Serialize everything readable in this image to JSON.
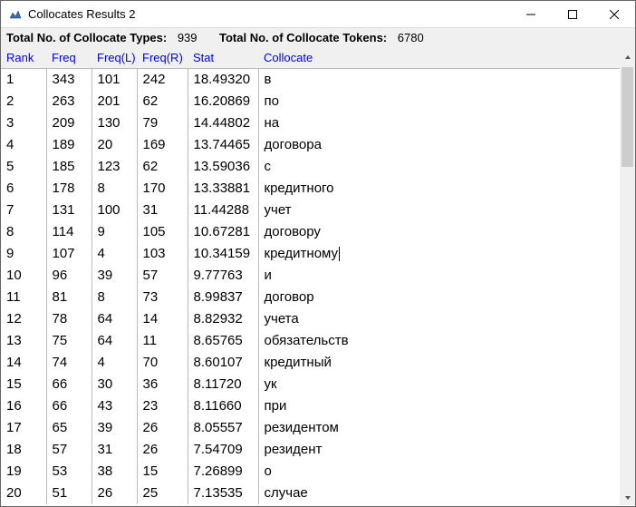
{
  "window": {
    "title": "Collocates Results 2"
  },
  "summary": {
    "types_label": "Total No. of Collocate Types:",
    "types_value": "939",
    "tokens_label": "Total No. of Collocate Tokens:",
    "tokens_value": "6780"
  },
  "headers": {
    "rank": "Rank",
    "freq": "Freq",
    "freql": "Freq(L)",
    "freqr": "Freq(R)",
    "stat": "Stat",
    "collocate": "Collocate"
  },
  "rows": [
    {
      "rank": "1",
      "freq": "343",
      "freql": "101",
      "freqr": "242",
      "stat": "18.49320",
      "collocate": "в"
    },
    {
      "rank": "2",
      "freq": "263",
      "freql": "201",
      "freqr": "62",
      "stat": "16.20869",
      "collocate": "по"
    },
    {
      "rank": "3",
      "freq": "209",
      "freql": "130",
      "freqr": "79",
      "stat": "14.44802",
      "collocate": "на"
    },
    {
      "rank": "4",
      "freq": "189",
      "freql": "20",
      "freqr": "169",
      "stat": "13.74465",
      "collocate": "договора"
    },
    {
      "rank": "5",
      "freq": "185",
      "freql": "123",
      "freqr": "62",
      "stat": "13.59036",
      "collocate": "с"
    },
    {
      "rank": "6",
      "freq": "178",
      "freql": "8",
      "freqr": "170",
      "stat": "13.33881",
      "collocate": "кредитного"
    },
    {
      "rank": "7",
      "freq": "131",
      "freql": "100",
      "freqr": "31",
      "stat": "11.44288",
      "collocate": "учет"
    },
    {
      "rank": "8",
      "freq": "114",
      "freql": "9",
      "freqr": "105",
      "stat": "10.67281",
      "collocate": "договору"
    },
    {
      "rank": "9",
      "freq": "107",
      "freql": "4",
      "freqr": "103",
      "stat": "10.34159",
      "collocate": "кредитному",
      "cursor": true
    },
    {
      "rank": "10",
      "freq": "96",
      "freql": "39",
      "freqr": "57",
      "stat": "9.77763",
      "collocate": "и"
    },
    {
      "rank": "11",
      "freq": "81",
      "freql": "8",
      "freqr": "73",
      "stat": "8.99837",
      "collocate": "договор"
    },
    {
      "rank": "12",
      "freq": "78",
      "freql": "64",
      "freqr": "14",
      "stat": "8.82932",
      "collocate": "учета"
    },
    {
      "rank": "13",
      "freq": "75",
      "freql": "64",
      "freqr": "11",
      "stat": "8.65765",
      "collocate": "обязательств"
    },
    {
      "rank": "14",
      "freq": "74",
      "freql": "4",
      "freqr": "70",
      "stat": "8.60107",
      "collocate": "кредитный"
    },
    {
      "rank": "15",
      "freq": "66",
      "freql": "30",
      "freqr": "36",
      "stat": "8.11720",
      "collocate": "ук"
    },
    {
      "rank": "16",
      "freq": "66",
      "freql": "43",
      "freqr": "23",
      "stat": "8.11660",
      "collocate": "при"
    },
    {
      "rank": "17",
      "freq": "65",
      "freql": "39",
      "freqr": "26",
      "stat": "8.05557",
      "collocate": "резидентом"
    },
    {
      "rank": "18",
      "freq": "57",
      "freql": "31",
      "freqr": "26",
      "stat": "7.54709",
      "collocate": "резидент"
    },
    {
      "rank": "19",
      "freq": "53",
      "freql": "38",
      "freqr": "15",
      "stat": "7.26899",
      "collocate": "о"
    },
    {
      "rank": "20",
      "freq": "51",
      "freql": "26",
      "freqr": "25",
      "stat": "7.13535",
      "collocate": "случае"
    }
  ]
}
